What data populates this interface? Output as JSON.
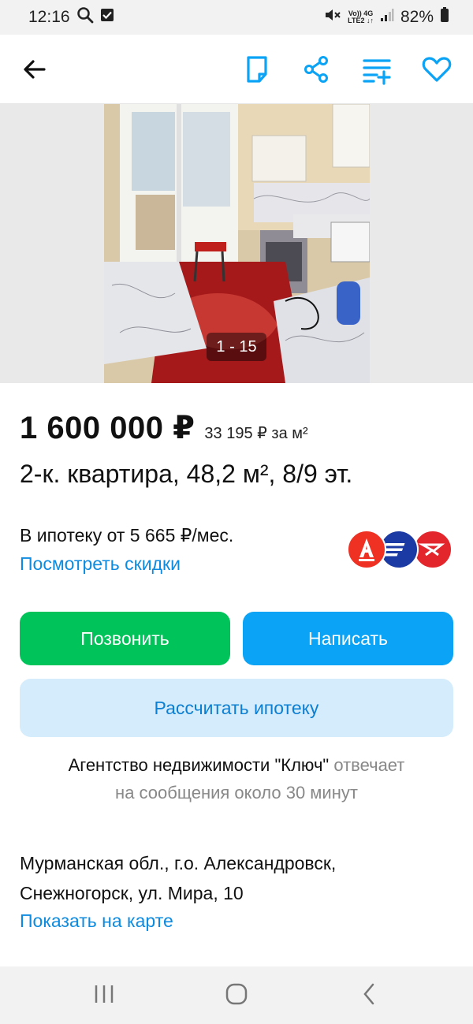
{
  "status_bar": {
    "time": "12:16",
    "network_line1": "Vo)) 4G",
    "network_line2": "LTE2 ↓↑",
    "battery": "82%"
  },
  "nav": {
    "icons": [
      "back-arrow-icon",
      "note-icon",
      "share-icon",
      "compare-icon",
      "heart-icon"
    ]
  },
  "gallery": {
    "counter": "1 - 15"
  },
  "listing": {
    "price": "1 600 000 ₽",
    "price_per_m2": "33 195 ₽ за м²",
    "title": "2-к. квартира, 48,2 м², 8/9 эт."
  },
  "mortgage": {
    "text": "В ипотеку от 5 665 ₽/мес.",
    "discount_link": "Посмотреть скидки",
    "banks": [
      "alfa-bank-logo",
      "otkritie-bank-logo",
      "pochta-bank-logo"
    ]
  },
  "actions": {
    "call": "Позвонить",
    "write": "Написать",
    "calc_mortgage": "Рассчитать ипотеку"
  },
  "agency": {
    "name": "Агентство недвижимости \"Ключ\"",
    "line1_rest": " отвечает",
    "line2": "на сообщения около 30 минут"
  },
  "location": {
    "address_line1": "Мурманская обл., г.о. Александровск,",
    "address_line2": "Снежногорск, ул. Мира, 10",
    "map_link": "Показать на карте"
  },
  "colors": {
    "green": "#00c45a",
    "blue": "#0aa3f5",
    "link": "#0d8be0",
    "light_blue": "#d4ecfb"
  }
}
